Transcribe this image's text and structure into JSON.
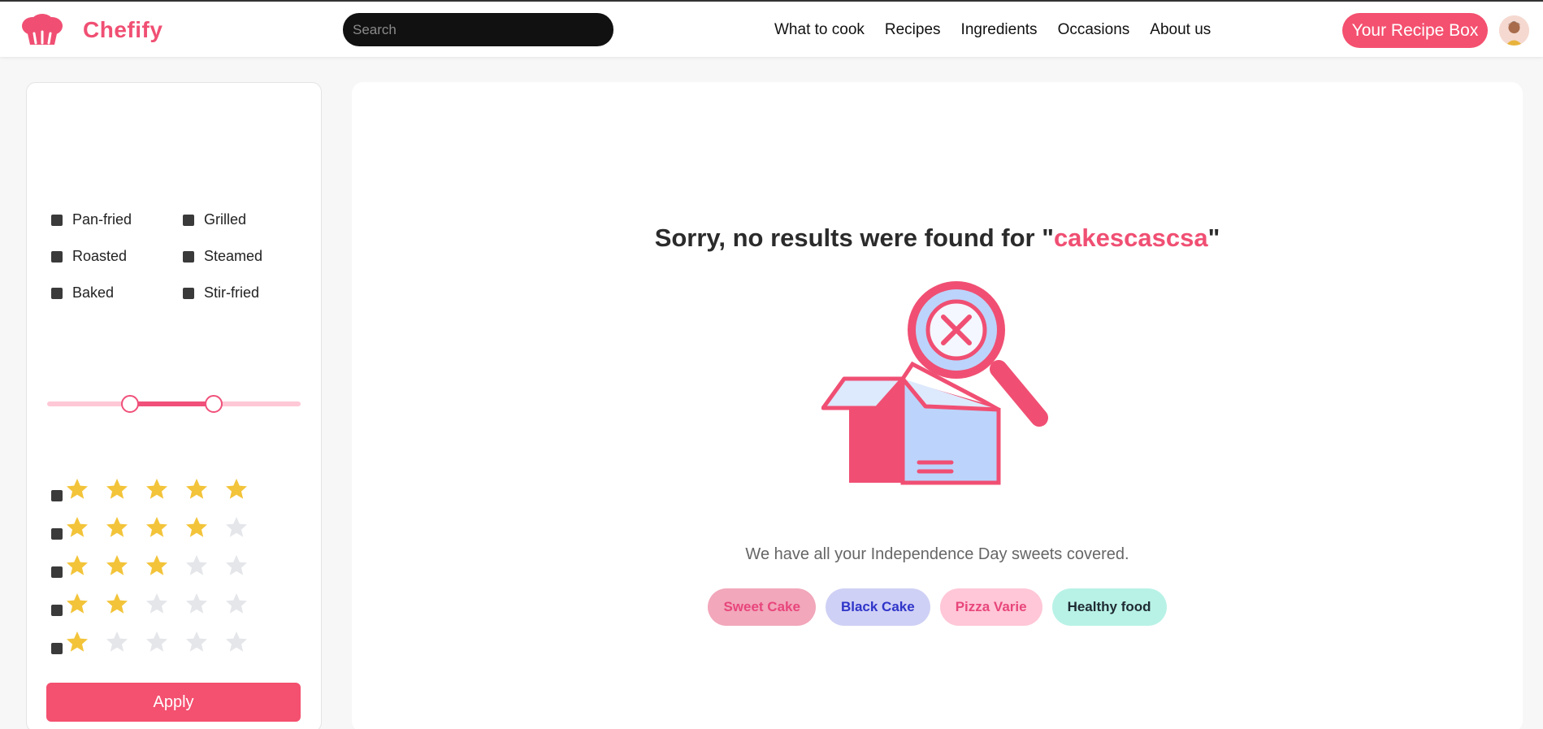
{
  "header": {
    "brand": "Chefify",
    "search_placeholder": "Search",
    "nav": [
      "What to cook",
      "Recipes",
      "Ingredients",
      "Occasions",
      "About us"
    ],
    "recipe_box_label": "Your Recipe Box"
  },
  "sidebar": {
    "cooking_methods": [
      "Pan-fried",
      "Grilled",
      "Roasted",
      "Steamed",
      "Baked",
      "Stir-fried"
    ],
    "ratings": [
      5,
      4,
      3,
      2,
      1
    ],
    "apply_label": "Apply"
  },
  "main": {
    "title_prefix": "Sorry, no results were found for \"",
    "query": "cakescascsa",
    "title_suffix": "\"",
    "subtitle": "We have all your Independence Day sweets covered.",
    "tags": [
      {
        "label": "Sweet Cake",
        "bg": "#f2a7bb",
        "color": "#e8467c"
      },
      {
        "label": "Black Cake",
        "bg": "#cfd0f5",
        "color": "#2f35c9"
      },
      {
        "label": "Pizza Varie",
        "bg": "#ffc7d7",
        "color": "#e8467c"
      },
      {
        "label": "Healthy food",
        "bg": "#b8f2e6",
        "color": "#1f2b33"
      }
    ]
  },
  "colors": {
    "brand": "#f04f73",
    "star_filled": "#f3c43a",
    "star_empty": "#e4e6ea"
  }
}
